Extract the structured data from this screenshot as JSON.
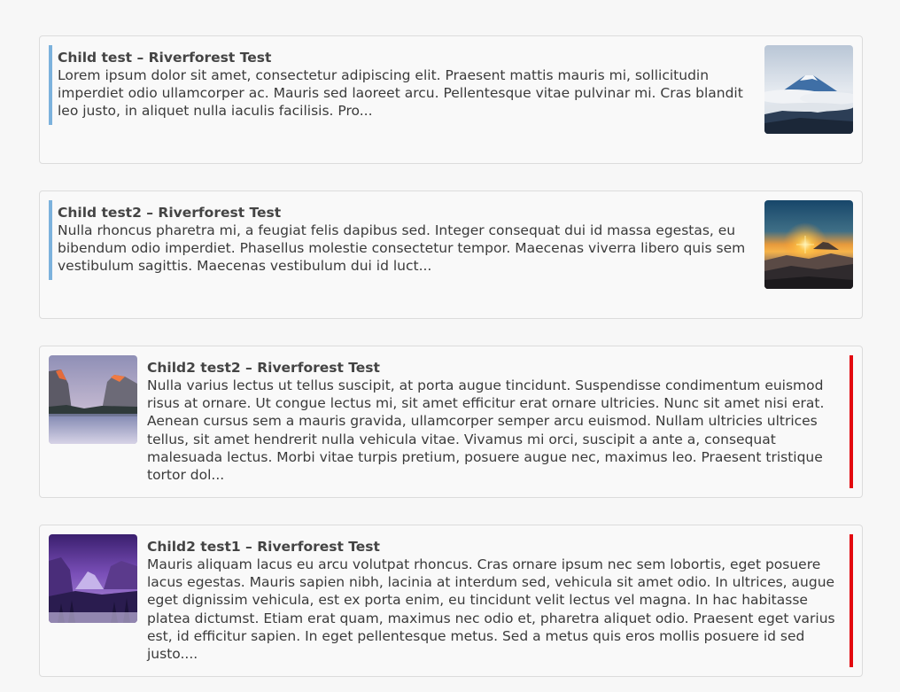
{
  "posts": [
    {
      "title": "Child test – Riverforest Test",
      "excerpt": "Lorem ipsum dolor sit amet, consectetur adipiscing elit. Praesent mattis mauris mi, sollicitudin imperdiet odio ullamcorper ac. Mauris sed laoreet arcu. Pellentesque vitae pulvinar mi. Cras blandit leo justo, in aliquet nulla iaculis facilisis. Pro...",
      "accent_color": "#7cb2dd"
    },
    {
      "title": "Child test2 – Riverforest Test",
      "excerpt": "Nulla rhoncus pharetra mi, a feugiat felis dapibus sed. Integer consequat dui id massa egestas, eu bibendum odio imperdiet. Phasellus molestie consectetur tempor. Maecenas viverra libero quis sem vestibulum sagittis. Maecenas vestibulum dui id luct...",
      "accent_color": "#7cb2dd"
    },
    {
      "title": "Child2 test2 – Riverforest Test",
      "excerpt": "Nulla varius lectus ut tellus suscipit, at porta augue tincidunt. Suspendisse condimentum euismod risus at ornare. Ut congue lectus mi, sit amet efficitur erat ornare ultricies. Nunc sit amet nisi erat. Aenean cursus sem a mauris gravida, ullamcorper semper arcu euismod. Nullam ultricies ultrices tellus, sit amet hendrerit nulla vehicula vitae. Vivamus mi orci, suscipit a ante a, consequat malesuada lectus. Morbi vitae turpis pretium, posuere augue nec, maximus leo. Praesent tristique tortor dol...",
      "accent_color": "#e3090f"
    },
    {
      "title": "Child2 test1 – Riverforest Test",
      "excerpt": "Mauris aliquam lacus eu arcu volutpat rhoncus. Cras ornare ipsum nec sem lobortis, eget posuere lacus egestas. Mauris sapien nibh, lacinia at interdum sed, vehicula sit amet odio. In ultrices, augue eget dignissim vehicula, est ex porta enim, eu tincidunt velit lectus vel magna. In hac habitasse platea dictumst. Etiam erat quam, maximus nec odio et, pharetra aliquet odio. Praesent eget varius est, id efficitur sapien. In eget pellentesque metus. Sed a metus quis eros mollis posuere id sed justo....",
      "accent_color": "#e3090f"
    }
  ]
}
